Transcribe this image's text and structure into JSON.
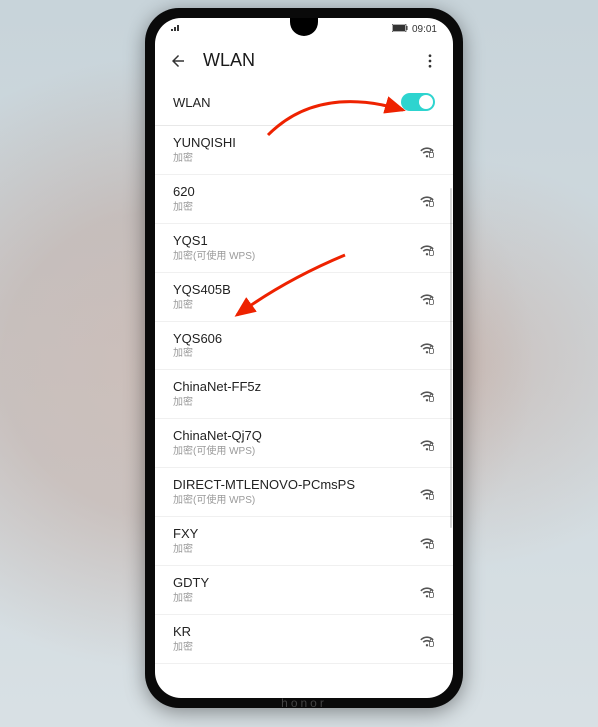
{
  "statusbar": {
    "time": "09:01"
  },
  "header": {
    "title": "WLAN"
  },
  "wlan_toggle": {
    "label": "WLAN",
    "state": "on"
  },
  "networks": [
    {
      "ssid": "YUNQISHI",
      "security": "加密"
    },
    {
      "ssid": "620",
      "security": "加密"
    },
    {
      "ssid": "YQS1",
      "security": "加密(可使用 WPS)"
    },
    {
      "ssid": "YQS405B",
      "security": "加密"
    },
    {
      "ssid": "YQS606",
      "security": "加密"
    },
    {
      "ssid": "ChinaNet-FF5z",
      "security": "加密"
    },
    {
      "ssid": "ChinaNet-Qj7Q",
      "security": "加密(可使用 WPS)"
    },
    {
      "ssid": "DIRECT-MTLENOVO-PCmsPS",
      "security": "加密(可使用 WPS)"
    },
    {
      "ssid": "FXY",
      "security": "加密"
    },
    {
      "ssid": "GDTY",
      "security": "加密"
    },
    {
      "ssid": "KR",
      "security": "加密"
    }
  ],
  "brand": "honor",
  "annotations": {
    "arrow1_target": "wlan-toggle",
    "arrow2_target": "network-YQS405B"
  }
}
